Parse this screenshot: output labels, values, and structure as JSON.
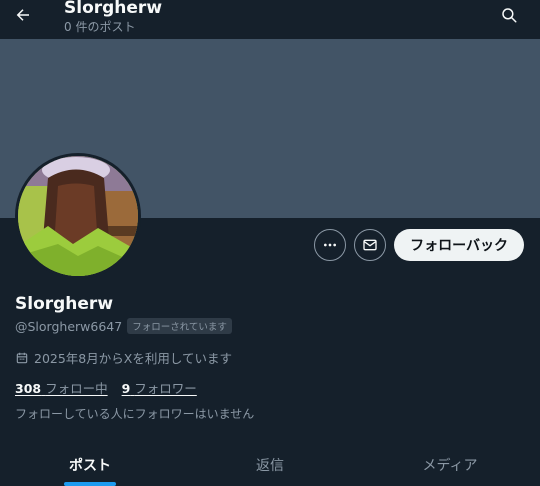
{
  "header": {
    "title": "Slorgherw",
    "post_count": "0 件のポスト",
    "back_icon": "arrow-left-icon",
    "search_icon": "search-icon"
  },
  "profile": {
    "name": "Slorgherw",
    "handle": "@Slorgherw6647",
    "follows_you_badge": "フォローされています",
    "joined": "2025年8月からXを利用しています",
    "following_count": "308",
    "following_label": "フォロー中",
    "followers_count": "9",
    "followers_label": "フォロワー",
    "followers_note": "フォローしている人にフォロワーはいません"
  },
  "actions": {
    "more_icon": "more-icon",
    "message_icon": "mail-icon",
    "follow_back_label": "フォローバック"
  },
  "tabs": [
    {
      "label": "ポスト",
      "active": true
    },
    {
      "label": "返信",
      "active": false
    },
    {
      "label": "メディア",
      "active": false
    }
  ],
  "colors": {
    "background": "#15202b",
    "banner": "#425466",
    "accent": "#1d9bf0",
    "muted_text": "#8b98a5"
  }
}
